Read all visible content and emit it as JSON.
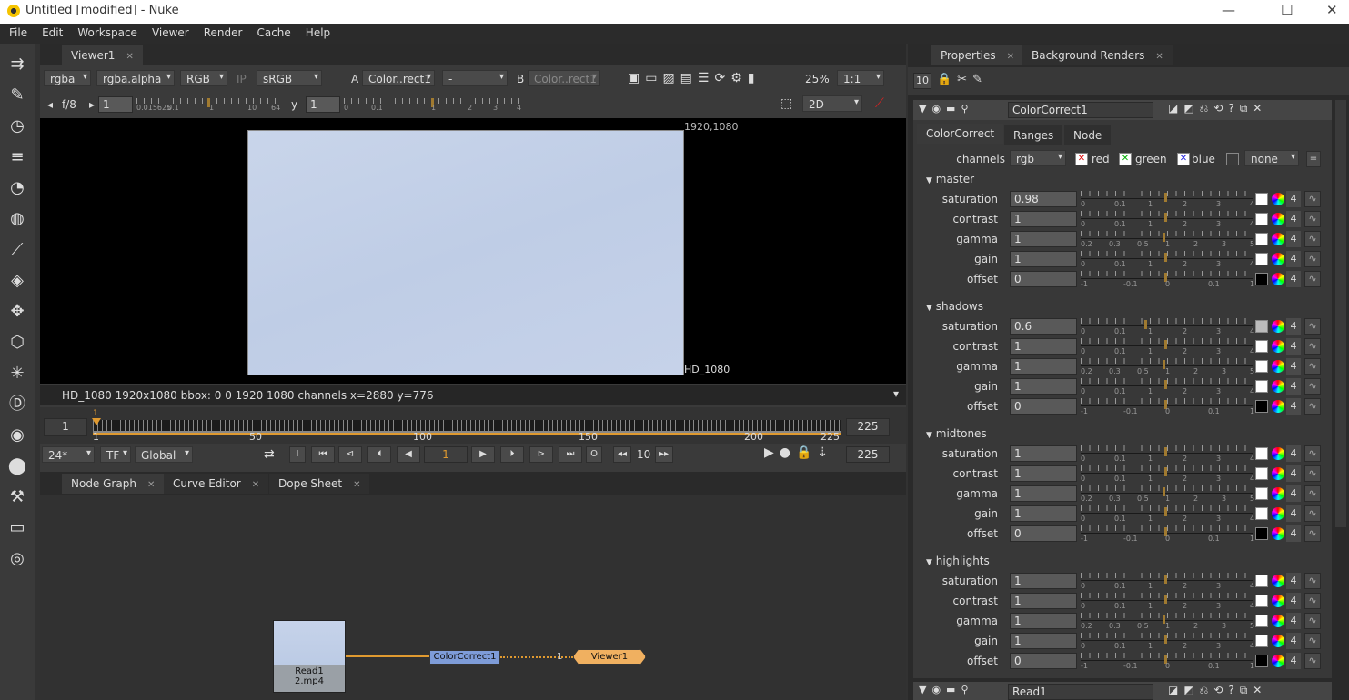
{
  "window": {
    "title": "Untitled [modified] - Nuke"
  },
  "menu": [
    "File",
    "Edit",
    "Workspace",
    "Viewer",
    "Render",
    "Cache",
    "Help"
  ],
  "viewer": {
    "tab": "Viewer1",
    "layer": "rgba",
    "alpha": "rgba.alpha",
    "display": "RGB",
    "ip": "IP",
    "lut": "sRGB",
    "a_label": "A",
    "a_input": "Color..rect1",
    "dash": "-",
    "b_label": "B",
    "b_input": "Color..rect1",
    "zoom": "25%",
    "ratio": "1:1",
    "fstop": "f/8",
    "gain": "1",
    "gamma_label": "y",
    "gamma": "1",
    "mode": "2D",
    "res_top": "1920,1080",
    "res_bottom": "HD_1080",
    "gain_ticks": [
      "0.015625",
      "0.1",
      "1",
      "10",
      "64"
    ],
    "gamma_ticks": [
      "0",
      "0.1",
      "1",
      "2",
      "3",
      "4"
    ],
    "info": "HD_1080 1920x1080  bbox: 0 0 1920 1080 channels  x=2880 y=776"
  },
  "timeline": {
    "start": "1",
    "end": "225",
    "current": "1",
    "marks": [
      "1",
      "50",
      "100",
      "150",
      "200",
      "225"
    ],
    "fps": "24*",
    "tf": "TF",
    "global": "Global",
    "frame": "1",
    "step": "10",
    "end_field": "225",
    "cursor": "1",
    "in_btn": "I",
    "out_btn": "O"
  },
  "bottom_tabs": [
    "Node Graph",
    "Curve Editor",
    "Dope Sheet"
  ],
  "nodes": {
    "read_name": "Read1",
    "read_file": "2.mp4",
    "cc": "ColorCorrect1",
    "viewer": "Viewer1",
    "input_num": "1"
  },
  "properties": {
    "tabs": [
      "Properties",
      "Background Renders"
    ],
    "max_panels": "10",
    "node_name": "ColorCorrect1",
    "inner_tabs": [
      "ColorCorrect",
      "Ranges",
      "Node"
    ],
    "channels_label": "channels",
    "channels": "rgb",
    "red": "red",
    "green": "green",
    "blue": "blue",
    "mask": "none",
    "eq": "=",
    "sections": [
      {
        "name": "master",
        "rows": [
          [
            "saturation",
            "0.98"
          ],
          [
            "contrast",
            "1"
          ],
          [
            "gamma",
            "1"
          ],
          [
            "gain",
            "1"
          ],
          [
            "offset",
            "0"
          ]
        ]
      },
      {
        "name": "shadows",
        "rows": [
          [
            "saturation",
            "0.6"
          ],
          [
            "contrast",
            "1"
          ],
          [
            "gamma",
            "1"
          ],
          [
            "gain",
            "1"
          ],
          [
            "offset",
            "0"
          ]
        ]
      },
      {
        "name": "midtones",
        "rows": [
          [
            "saturation",
            "1"
          ],
          [
            "contrast",
            "1"
          ],
          [
            "gamma",
            "1"
          ],
          [
            "gain",
            "1"
          ],
          [
            "offset",
            "0"
          ]
        ]
      },
      {
        "name": "highlights",
        "rows": [
          [
            "saturation",
            "1"
          ],
          [
            "contrast",
            "1"
          ],
          [
            "gamma",
            "1"
          ],
          [
            "gain",
            "1"
          ],
          [
            "offset",
            "0"
          ]
        ]
      }
    ],
    "four": "4",
    "tick_sets": {
      "saturation": [
        "0",
        "0.1",
        "1",
        "2",
        "3",
        "4"
      ],
      "contrast": [
        "0",
        "0.1",
        "1",
        "2",
        "3",
        "4"
      ],
      "gamma": [
        "0.2",
        "0.3",
        "0.5",
        "1",
        "2",
        "3",
        "5"
      ],
      "gain": [
        "0",
        "0.1",
        "1",
        "2",
        "3",
        "4"
      ],
      "offset": [
        "-1",
        "-0.1",
        "0",
        "0.1",
        "1"
      ]
    },
    "next_node": "Read1"
  }
}
